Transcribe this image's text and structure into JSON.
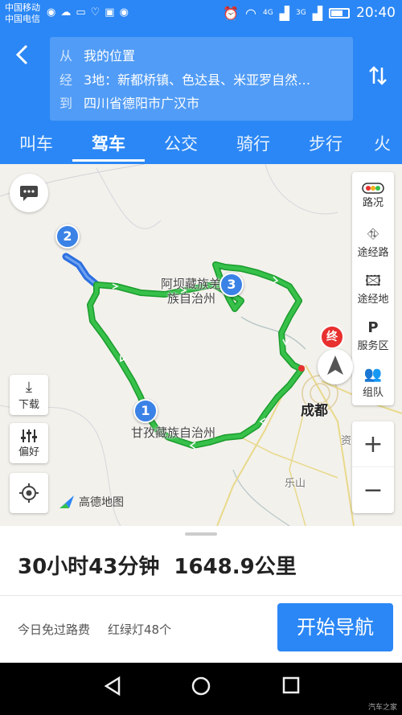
{
  "status_bar": {
    "carrier_1": "中国移动",
    "carrier_2": "中国电信",
    "network_4g": "4G",
    "network_3g": "3G",
    "time": "20:40"
  },
  "header": {
    "from_label": "从",
    "from_value": "我的位置",
    "via_label": "经",
    "via_value": "3地：新都桥镇、色达县、米亚罗自然…",
    "to_label": "到",
    "to_value": "四川省德阳市广汉市"
  },
  "tabs": [
    {
      "label": "叫车"
    },
    {
      "label": "驾车"
    },
    {
      "label": "公交"
    },
    {
      "label": "骑行"
    },
    {
      "label": "步行"
    },
    {
      "label": "火"
    }
  ],
  "active_tab": "驾车",
  "map": {
    "labels": {
      "aba_1": "阿坝藏族羌",
      "aba_2": "族自治州",
      "ganzi": "甘孜藏族自治州",
      "chengdu": "成都",
      "leshan": "乐山",
      "zi": "资"
    },
    "waypoints": [
      "1",
      "2",
      "3"
    ],
    "end_marker": "终",
    "logo_text": "高德地图"
  },
  "map_controls": {
    "traffic": "路况",
    "via_route": "途经路",
    "via_place": "途经地",
    "service": "服务区",
    "team": "组队",
    "download": "下载",
    "preference": "偏好",
    "zoom_in": "+",
    "zoom_out": "−"
  },
  "route_summary": {
    "duration": "30小时43分钟",
    "distance": "1648.9公里",
    "toll": "今日免过路费",
    "traffic_lights": "红绿灯48个",
    "start_button": "开始导航"
  },
  "watermark": "汽车之家",
  "colors": {
    "primary": "#2b87f5",
    "route_green": "#19a82f",
    "end_red": "#e8302f"
  }
}
